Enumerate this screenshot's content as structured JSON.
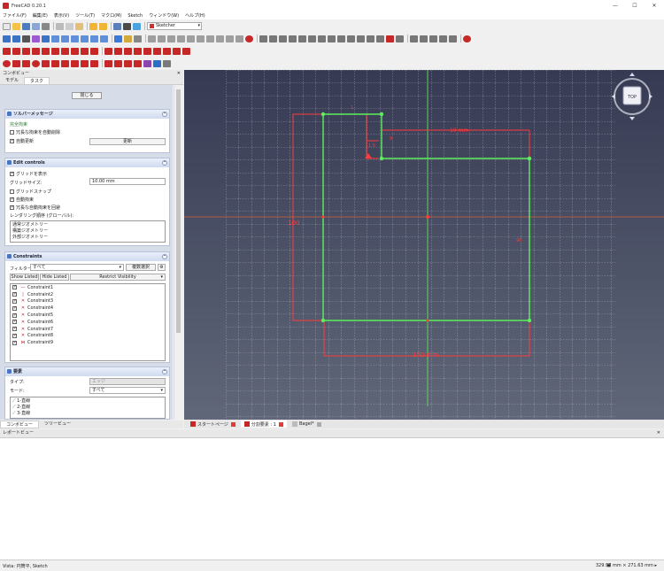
{
  "window": {
    "title": "FreeCAD 0.20.1",
    "minimize": "—",
    "maximize": "☐",
    "close": "✕"
  },
  "menu": [
    "ファイル(F)",
    "編集(E)",
    "表示(V)",
    "ツール(T)",
    "マクロ(M)",
    "Sketch",
    "ウィンドウ(W)",
    "ヘルプ(H)"
  ],
  "workbench": "Sketcher",
  "combo_view": {
    "title": "コンボビュー",
    "close": "✕",
    "tabs": [
      "モデル",
      "タスク"
    ],
    "close_button": "閉じる",
    "solver": {
      "title": "ソルバーメッセージ",
      "status": "完全拘束",
      "auto_remove_label": "冗長な拘束を自動削除",
      "auto_update_label": "自動更新",
      "update_button": "更新"
    },
    "edit_controls": {
      "title": "Edit controls",
      "show_grid": "グリッドを表示",
      "grid_size_label": "グリッドサイズ:",
      "grid_size_value": "10.00 mm",
      "grid_snap": "グリッドスナップ",
      "auto_constraints": "自動拘束",
      "avoid_redundant": "冗長な自動拘束を回避",
      "render_order": "レンダリング順序 (グローバル):",
      "render_items": [
        "通常ジオメトリー",
        "構築ジオメトリー",
        "外部ジオメトリー"
      ]
    },
    "constraints": {
      "title": "Constraints",
      "filter_label": "フィルター:",
      "filter_value": "すべて",
      "multi_filter": "複数選択",
      "show_listed": "Show Listed",
      "hide_listed": "Hide Listed",
      "restrict": "Restrict Visibility",
      "items": [
        {
          "sym": "—",
          "color": "#c62828",
          "name": "Constraint1"
        },
        {
          "sym": "|",
          "color": "#c62828",
          "name": "Constraint2"
        },
        {
          "sym": "✕",
          "color": "#c62828",
          "name": "Constraint3"
        },
        {
          "sym": "✕",
          "color": "#c62828",
          "name": "Constraint4"
        },
        {
          "sym": "✕",
          "color": "#c62828",
          "name": "Constraint5"
        },
        {
          "sym": "✕",
          "color": "#c62828",
          "name": "Constraint6"
        },
        {
          "sym": "✕",
          "color": "#c62828",
          "name": "Constraint7"
        },
        {
          "sym": "✕",
          "color": "#c62828",
          "name": "Constraint8"
        },
        {
          "sym": "⋈",
          "color": "#c62828",
          "name": "Constraint9"
        }
      ]
    },
    "elements": {
      "title": "要素",
      "type_label": "タイプ:",
      "type_value": "エッジ",
      "mode_label": "モード:",
      "mode_value": "すべて",
      "items": [
        "1-直線",
        "2-直線",
        "3-直線"
      ]
    },
    "bottom_tabs": [
      "コンボビュー",
      "ツリービュー"
    ]
  },
  "mdi_tabs": [
    "スタートページ",
    "分割要素 : 1",
    "Bagel*"
  ],
  "viewport": {
    "dim_150": "150 mm",
    "dim_small_1": "1.5",
    "dim_small_2": "9",
    "dim_small_3": "1",
    "dim_v": "100",
    "dim_mid": "90",
    "dim_top": "10 mm",
    "navcube": "TOP"
  },
  "report_view": {
    "title": "レポートビュー",
    "close": "✕"
  },
  "status": {
    "left": "Vista: 円筒平, Sketch",
    "right": "329.98 mm × 271.63 mm ▸"
  }
}
